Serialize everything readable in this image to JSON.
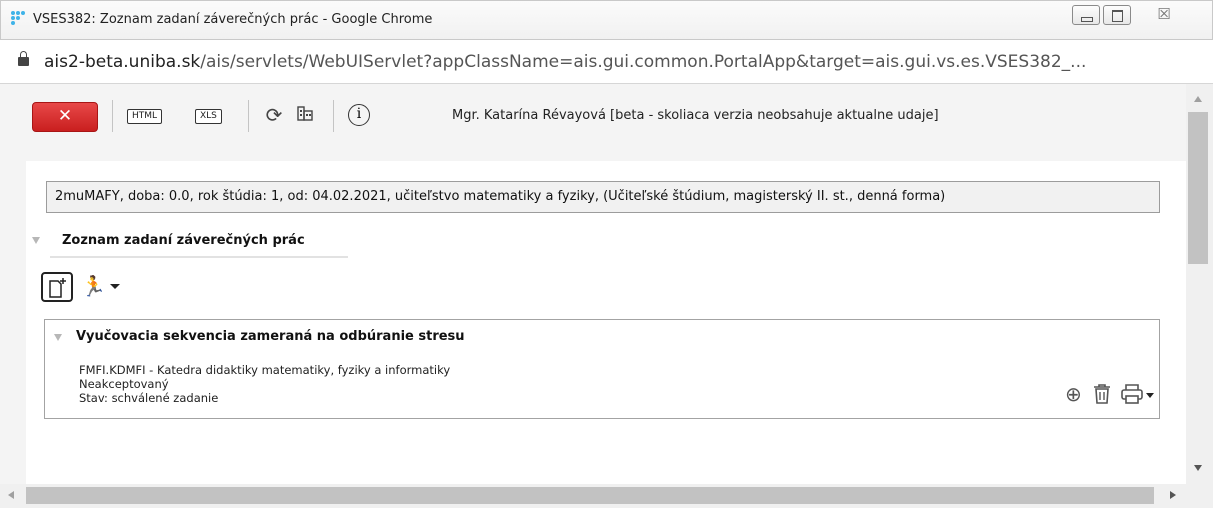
{
  "window": {
    "title": "VSES382: Zoznam zadaní záverečných prác - Google Chrome",
    "icon": "app-dots-icon",
    "close_glyph": "☒"
  },
  "address": {
    "domain": "ais2-beta.uniba.sk",
    "path": "/ais/servlets/WebUIServlet?appClassName=ais.gui.common.PortalApp&target=ais.gui.vs.es.VSES382_..."
  },
  "toolbar": {
    "close_glyph": "✕",
    "html_label": "HTML",
    "xls_label": "XLS",
    "refresh_glyph": "⟳",
    "user_text": "Mgr. Katarína Révayová [beta - skoliaca verzia neobsahuje aktualne udaje]",
    "info_glyph": "i"
  },
  "study": {
    "summary": "2muMAFY, doba: 0.0, rok štúdia: 1, od: 04.02.2021, učiteľstvo matematiky a fyziky, (Učiteľské štúdium, magisterský II. st., denná forma)"
  },
  "section": {
    "title": "Zoznam zadaní záverečných prác",
    "runner_glyph": "🏃"
  },
  "thesis": {
    "title": "Vyučovacia sekvencia zameraná na odbúranie stresu",
    "department": "FMFI.KDMFI - Katedra didaktiky matematiky, fyziky a informatiky",
    "acceptance": "Neakceptovaný",
    "state": "Stav: schválené zadanie",
    "zoom_glyph": "⊕",
    "delete_glyph": "🗑",
    "print_glyph": "🖶"
  },
  "colors": {
    "close_button": "#d42b2b",
    "accent_icon": "#3fb3e8"
  }
}
